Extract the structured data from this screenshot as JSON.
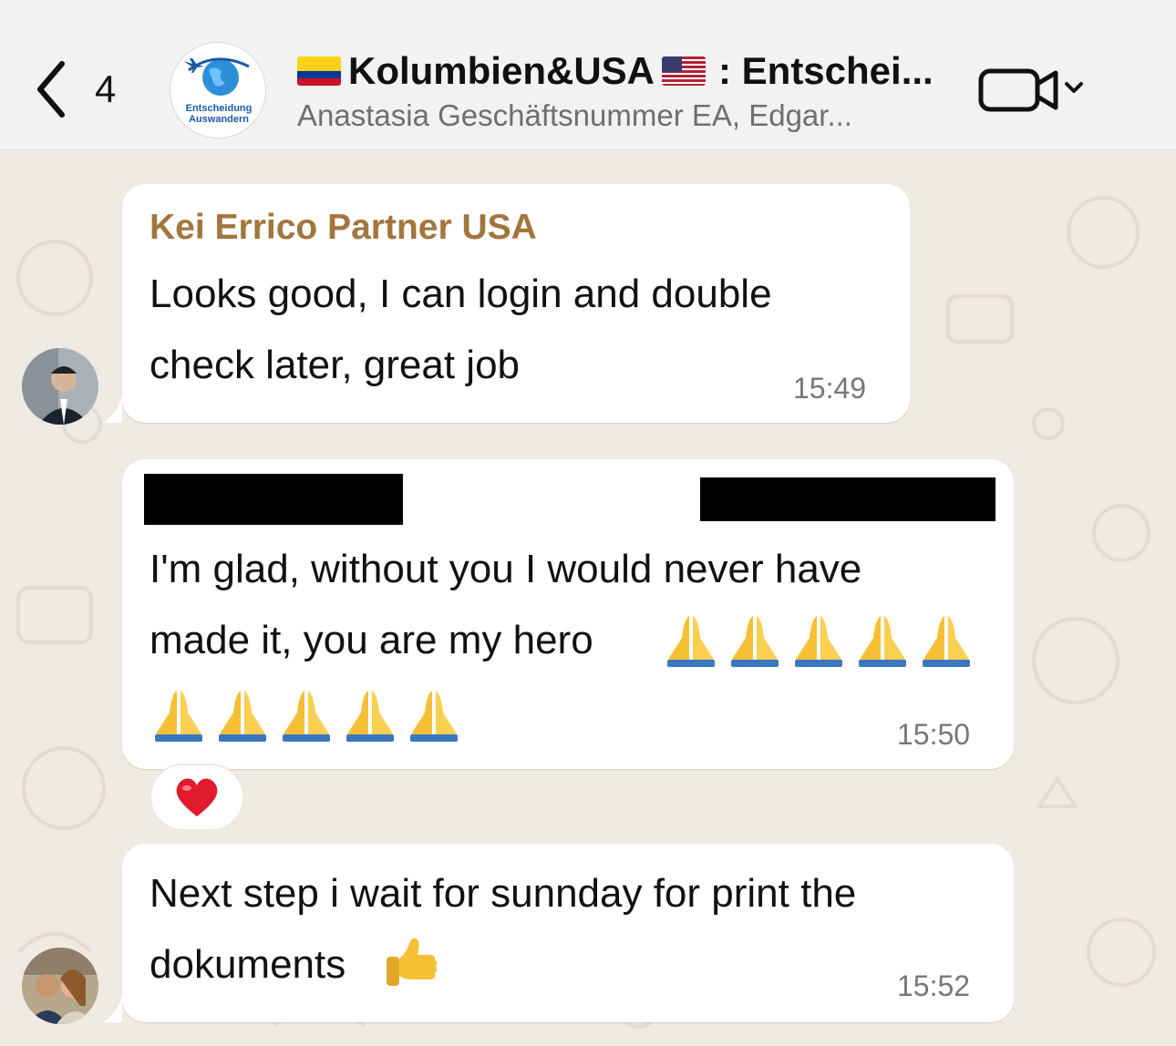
{
  "header": {
    "back_count": "4",
    "group_logo_line1": "Entscheidung",
    "group_logo_line2": "Auswandern",
    "title_part1": "Kolumbien&USA",
    "title_part2": ": Entschei...",
    "subtitle": "Anastasia Geschäftsnummer EA, Edgar..."
  },
  "messages": [
    {
      "sender": "Kei Errico Partner USA",
      "line1": "Looks good, I can login and double",
      "line2": "check later, great job",
      "time": "15:49"
    },
    {
      "sender": "",
      "line1": "I'm glad, without you I would never have",
      "line2": "made it, you are my hero",
      "time": "15:50",
      "reaction": "red-heart-icon"
    },
    {
      "line1": "Next step i wait for sunnday for print the",
      "line2": "dokuments",
      "time": "15:52"
    }
  ],
  "icons": {
    "back": "chevron-left-icon",
    "video": "video-call-icon",
    "prayer": "folded-hands-emoji",
    "thumbs": "thumbs-up-emoji"
  },
  "colors": {
    "sender_name": "#a3753e",
    "chat_background": "#efeae2",
    "header_background": "#f2f2f2"
  }
}
